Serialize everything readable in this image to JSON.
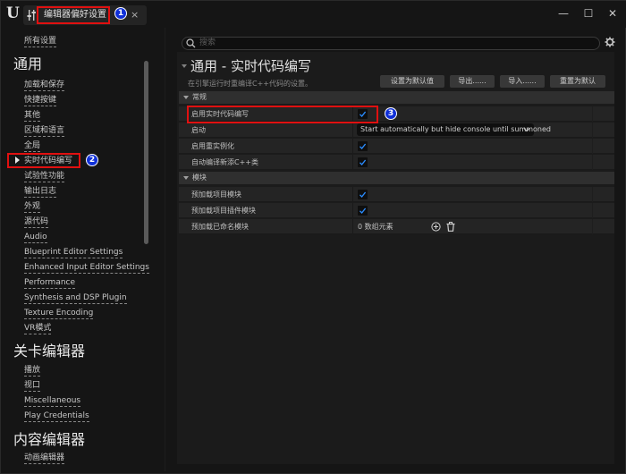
{
  "window": {
    "tab_title": "编辑器偏好设置",
    "tab_close": "×",
    "controls": {
      "minimize": "—",
      "maximize": "☐",
      "close": "✕"
    }
  },
  "annotations": [
    "1",
    "2",
    "3"
  ],
  "sidebar": {
    "all_settings": "所有设置",
    "categories": [
      {
        "title": "通用",
        "items": [
          "加载和保存",
          "快捷按键",
          "其他",
          "区域和语言",
          "全局",
          "实时代码编写",
          "试验性功能",
          "输出日志",
          "外观",
          "源代码",
          "Audio",
          "Blueprint Editor Settings",
          "Enhanced Input Editor Settings",
          "Performance",
          "Synthesis and DSP Plugin",
          "Texture Encoding",
          "VR模式"
        ]
      },
      {
        "title": "关卡编辑器",
        "items": [
          "播放",
          "视口",
          "Miscellaneous",
          "Play Credentials"
        ]
      },
      {
        "title": "内容编辑器",
        "items": [
          "动画编辑器"
        ]
      }
    ],
    "selected": "实时代码编写"
  },
  "search": {
    "placeholder": "搜索"
  },
  "page": {
    "title": "通用 - 实时代码编写",
    "subtitle": "在引擎运行时重编译C++代码的设置。",
    "buttons": {
      "set_default": "设置为默认值",
      "export": "导出......",
      "import": "导入......",
      "reset": "重置为默认"
    }
  },
  "sections": [
    {
      "title": "常规",
      "rows": [
        {
          "label": "启用实时代码编写",
          "type": "checkbox",
          "checked": true
        },
        {
          "label": "启动",
          "type": "dropdown",
          "value": "Start automatically but hide console until summoned"
        },
        {
          "label": "启用重实例化",
          "type": "checkbox",
          "checked": true
        },
        {
          "label": "自动编译新添C++类",
          "type": "checkbox",
          "checked": true
        }
      ]
    },
    {
      "title": "模块",
      "rows": [
        {
          "label": "预加载项目模块",
          "type": "checkbox",
          "checked": true
        },
        {
          "label": "预加载项目插件模块",
          "type": "checkbox",
          "checked": true
        },
        {
          "label": "预加载已命名模块",
          "type": "array",
          "value": "0 数组元素"
        }
      ]
    }
  ],
  "colors": {
    "accent_check": "#2a8cff",
    "highlight_border": "#e01010",
    "marker_fill": "#1030d8"
  }
}
